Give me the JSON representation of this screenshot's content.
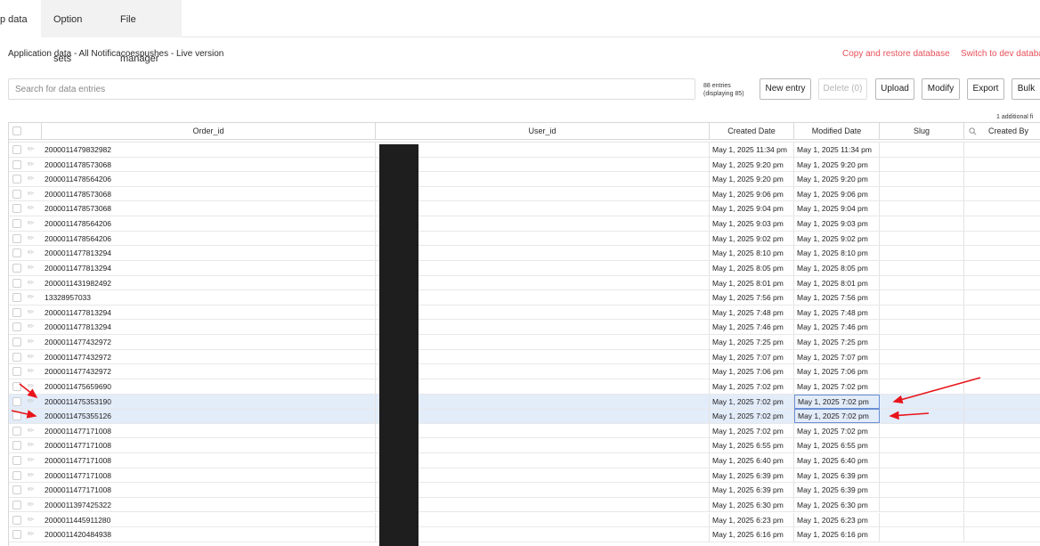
{
  "tabs": [
    {
      "label": "p data"
    },
    {
      "label": "Option sets"
    },
    {
      "label": "File manager"
    }
  ],
  "breadcrumb": "Application data - All Notificacoespushes - Live version",
  "links": {
    "copy_restore": "Copy and restore database",
    "switch_dev": "Switch to dev databa"
  },
  "search": {
    "placeholder": "Search for data entries",
    "value": ""
  },
  "entries": {
    "count": "88 entries",
    "displaying": "(displaying 85)"
  },
  "buttons": {
    "new_entry": "New entry",
    "delete": "Delete (0)",
    "upload": "Upload",
    "modify": "Modify",
    "export": "Export",
    "bulk": "Bulk"
  },
  "additional_fields": "1 additional fi",
  "columns": {
    "order_id": "Order_id",
    "user_id": "User_id",
    "created_date": "Created Date",
    "modified_date": "Modified Date",
    "slug": "Slug",
    "created_by": "Created By"
  },
  "icons": {
    "search": "search-icon",
    "edit": "pencil-icon",
    "annotation": "red-arrow"
  },
  "colors": {
    "link": "#e8505b",
    "selected_row": "#e3ecf9",
    "focus_border": "#6a8fd4",
    "annotation": "#e8141b"
  },
  "rows": [
    {
      "order_id": "2000011479832982",
      "created": "May 1, 2025 11:34 pm",
      "modified": "May 1, 2025 11:34 pm",
      "selected": false
    },
    {
      "order_id": "2000011478573068",
      "created": "May 1, 2025 9:20 pm",
      "modified": "May 1, 2025 9:20 pm",
      "selected": false
    },
    {
      "order_id": "2000011478564206",
      "created": "May 1, 2025 9:20 pm",
      "modified": "May 1, 2025 9:20 pm",
      "selected": false
    },
    {
      "order_id": "2000011478573068",
      "created": "May 1, 2025 9:06 pm",
      "modified": "May 1, 2025 9:06 pm",
      "selected": false
    },
    {
      "order_id": "2000011478573068",
      "created": "May 1, 2025 9:04 pm",
      "modified": "May 1, 2025 9:04 pm",
      "selected": false
    },
    {
      "order_id": "2000011478564206",
      "created": "May 1, 2025 9:03 pm",
      "modified": "May 1, 2025 9:03 pm",
      "selected": false
    },
    {
      "order_id": "2000011478564206",
      "created": "May 1, 2025 9:02 pm",
      "modified": "May 1, 2025 9:02 pm",
      "selected": false
    },
    {
      "order_id": "2000011477813294",
      "created": "May 1, 2025 8:10 pm",
      "modified": "May 1, 2025 8:10 pm",
      "selected": false
    },
    {
      "order_id": "2000011477813294",
      "created": "May 1, 2025 8:05 pm",
      "modified": "May 1, 2025 8:05 pm",
      "selected": false
    },
    {
      "order_id": "2000011431982492",
      "created": "May 1, 2025 8:01 pm",
      "modified": "May 1, 2025 8:01 pm",
      "selected": false
    },
    {
      "order_id": "13328957033",
      "created": "May 1, 2025 7:56 pm",
      "modified": "May 1, 2025 7:56 pm",
      "selected": false
    },
    {
      "order_id": "2000011477813294",
      "created": "May 1, 2025 7:48 pm",
      "modified": "May 1, 2025 7:48 pm",
      "selected": false
    },
    {
      "order_id": "2000011477813294",
      "created": "May 1, 2025 7:46 pm",
      "modified": "May 1, 2025 7:46 pm",
      "selected": false
    },
    {
      "order_id": "2000011477432972",
      "created": "May 1, 2025 7:25 pm",
      "modified": "May 1, 2025 7:25 pm",
      "selected": false
    },
    {
      "order_id": "2000011477432972",
      "created": "May 1, 2025 7:07 pm",
      "modified": "May 1, 2025 7:07 pm",
      "selected": false
    },
    {
      "order_id": "2000011477432972",
      "created": "May 1, 2025 7:06 pm",
      "modified": "May 1, 2025 7:06 pm",
      "selected": false
    },
    {
      "order_id": "2000011475659690",
      "created": "May 1, 2025 7:02 pm",
      "modified": "May 1, 2025 7:02 pm",
      "selected": false
    },
    {
      "order_id": "2000011475353190",
      "created": "May 1, 2025 7:02 pm",
      "modified": "May 1, 2025 7:02 pm",
      "selected": true
    },
    {
      "order_id": "2000011475355126",
      "created": "May 1, 2025 7:02 pm",
      "modified": "May 1, 2025 7:02 pm",
      "selected": true
    },
    {
      "order_id": "2000011477171008",
      "created": "May 1, 2025 7:02 pm",
      "modified": "May 1, 2025 7:02 pm",
      "selected": false
    },
    {
      "order_id": "2000011477171008",
      "created": "May 1, 2025 6:55 pm",
      "modified": "May 1, 2025 6:55 pm",
      "selected": false
    },
    {
      "order_id": "2000011477171008",
      "created": "May 1, 2025 6:40 pm",
      "modified": "May 1, 2025 6:40 pm",
      "selected": false
    },
    {
      "order_id": "2000011477171008",
      "created": "May 1, 2025 6:39 pm",
      "modified": "May 1, 2025 6:39 pm",
      "selected": false
    },
    {
      "order_id": "2000011477171008",
      "created": "May 1, 2025 6:39 pm",
      "modified": "May 1, 2025 6:39 pm",
      "selected": false
    },
    {
      "order_id": "2000011397425322",
      "created": "May 1, 2025 6:30 pm",
      "modified": "May 1, 2025 6:30 pm",
      "selected": false
    },
    {
      "order_id": "2000011445911280",
      "created": "May 1, 2025 6:23 pm",
      "modified": "May 1, 2025 6:23 pm",
      "selected": false
    },
    {
      "order_id": "2000011420484938",
      "created": "May 1, 2025 6:16 pm",
      "modified": "May 1, 2025 6:16 pm",
      "selected": false
    }
  ]
}
